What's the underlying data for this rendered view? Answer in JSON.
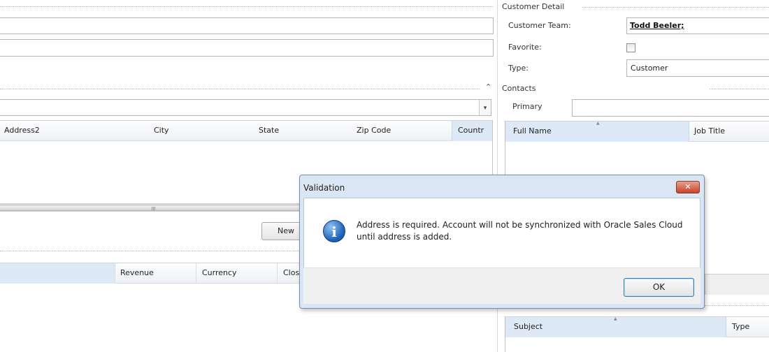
{
  "customer_detail": {
    "section_title": "Customer Detail",
    "team_label": "Customer Team:",
    "team_value": "Todd Beeler;",
    "favorite_label": "Favorite:",
    "type_label": "Type:",
    "type_value": "Customer"
  },
  "contacts": {
    "section_title": "Contacts",
    "primary_label": "Primary",
    "columns": [
      "Full Name",
      "Job Title"
    ]
  },
  "address_grid": {
    "columns": [
      "Address2",
      "City",
      "State",
      "Zip Code",
      "Countr"
    ],
    "scroll_grip": "III"
  },
  "opportunities": {
    "new_button": "New",
    "columns": [
      "Revenue",
      "Currency",
      "Clos"
    ]
  },
  "activities": {
    "columns": [
      "Subject",
      "Type"
    ]
  },
  "dialog": {
    "title": "Validation",
    "close_glyph": "✕",
    "message": "Address is required. Account will not be synchronized with Oracle Sales Cloud until address is added.",
    "ok_label": "OK",
    "info_glyph": "i"
  },
  "icons": {
    "collapse": "⌃",
    "dropdown": "▾",
    "sort": "▲"
  }
}
